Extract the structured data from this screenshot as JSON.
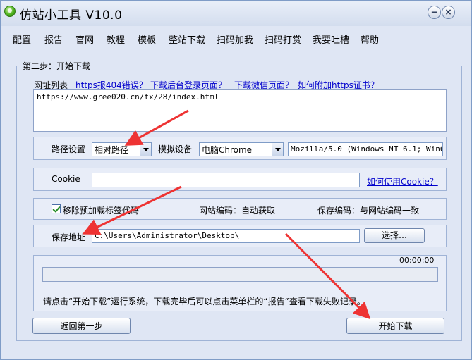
{
  "window": {
    "title": "仿站小工具 V10.0"
  },
  "menu": [
    "配置",
    "报告",
    "官网",
    "教程",
    "模板",
    "整站下载",
    "扫码加我",
    "扫码打赏",
    "我要吐槽",
    "帮助"
  ],
  "step": {
    "title": "第二步：开始下载"
  },
  "url_section": {
    "label": "网址列表",
    "links": [
      "https报404错误？",
      "下载后台登录页面？",
      "下载微信页面？",
      "如何附加https证书？"
    ],
    "url_value": "https://www.gree020.cn/tx/28/index.html"
  },
  "path_row": {
    "path_label": "路径设置",
    "path_value": "相对路径",
    "device_label": "模拟设备",
    "device_value": "电脑Chrome",
    "ua_value": "Mozilla/5.0 (Windows NT 6.1; Win64;"
  },
  "cookie_row": {
    "label": "Cookie",
    "value": "",
    "link": "如何使用Cookie？"
  },
  "options_row": {
    "checkbox_label": "移除预加载标签代码",
    "checked": true,
    "site_encoding": "网站编码：自动获取",
    "save_encoding": "保存编码：与网站编码一致"
  },
  "save_row": {
    "label": "保存地址",
    "value": "C:\\Users\\Administrator\\Desktop\\",
    "choose_button": "选择…"
  },
  "progress": {
    "time": "00:00:00",
    "fraction": 0,
    "hint": "请点击“开始下载”运行系统，下载完毕后可以点击菜单栏的“报告”查看下载失败记录。"
  },
  "buttons": {
    "back": "返回第一步",
    "start": "开始下载"
  },
  "annotation_color": "#ee3333"
}
